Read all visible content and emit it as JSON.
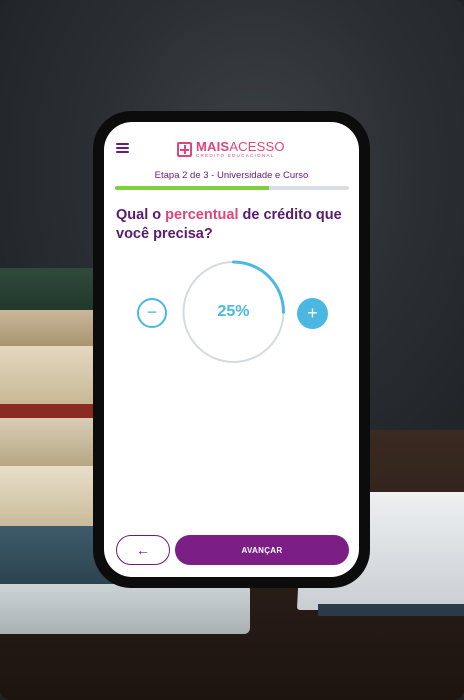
{
  "header": {
    "menu_icon": "hamburger-menu-icon",
    "logo": {
      "main_bold": "MAIS",
      "main_rest": "ACESSO",
      "sub": "CRÉDITO EDUCACIONAL"
    },
    "step_text": "Etapa 2 de 3 - Universidade e Curso",
    "progress_fraction": 0.66
  },
  "question": {
    "prefix": "Qual o ",
    "highlight": "percentual",
    "suffix": " de crédito que você precisa?"
  },
  "dial": {
    "value_label": "25%",
    "value_fraction": 0.25,
    "minus_icon": "minus-icon",
    "plus_icon": "plus-icon"
  },
  "footer": {
    "back_icon": "arrow-left-icon",
    "next_label": "AVANÇAR"
  },
  "colors": {
    "brand_purple": "#6a1a7a",
    "brand_pink": "#e0457b",
    "accent_blue": "#4cb7e0",
    "progress_green": "#7ed03d"
  }
}
